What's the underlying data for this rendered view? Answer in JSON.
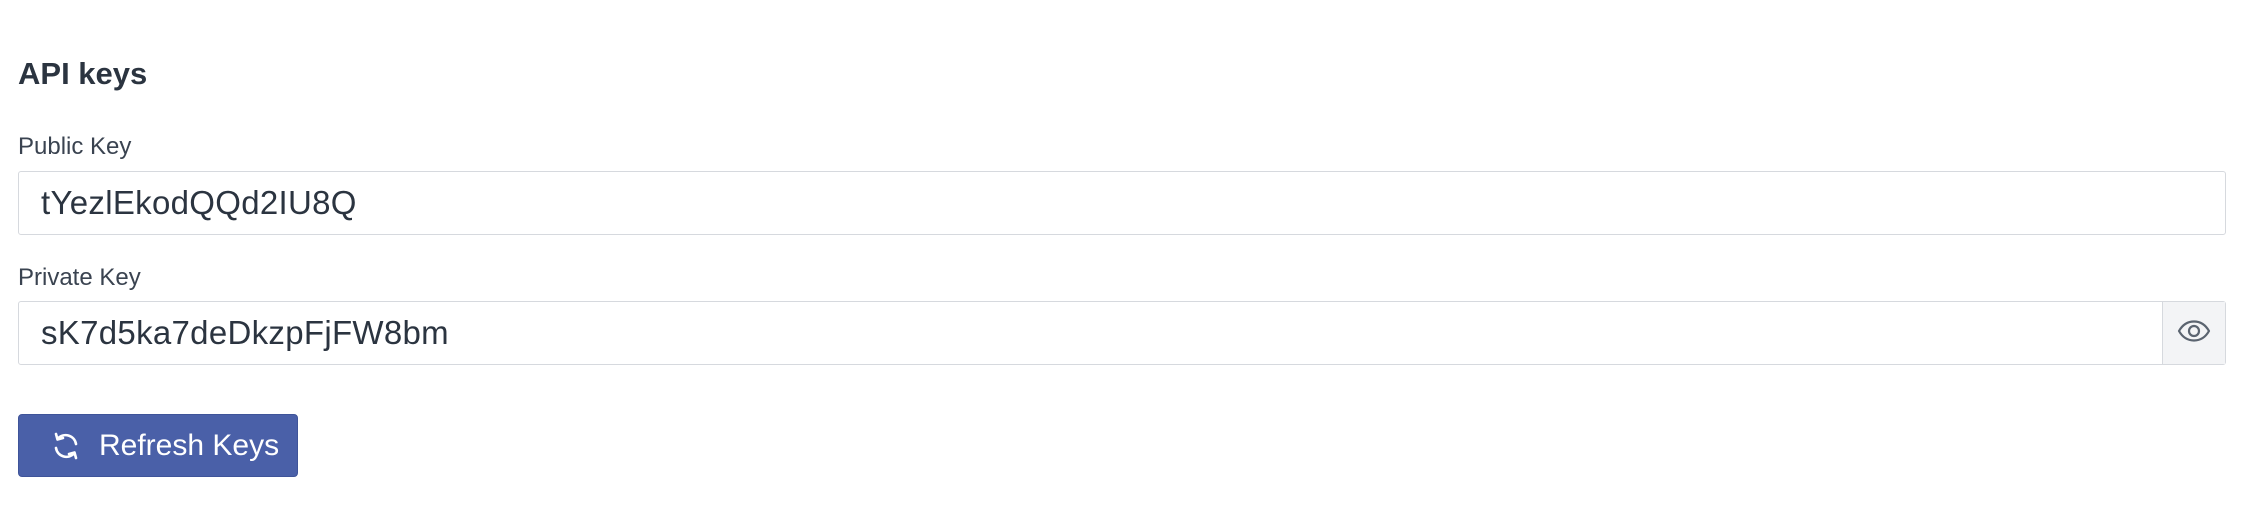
{
  "section": {
    "title": "API keys"
  },
  "public_key": {
    "label": "Public Key",
    "value": "tYezlEkodQQd2IU8Q"
  },
  "private_key": {
    "label": "Private Key",
    "value": "sK7d5ka7deDkzpFjFW8bm",
    "toggle_icon": "eye-icon"
  },
  "actions": {
    "refresh_label": "Refresh Keys",
    "refresh_icon": "refresh-icon"
  },
  "colors": {
    "primary_button": "#4a60a8",
    "text": "#2b3440",
    "border": "#d6d9de"
  }
}
